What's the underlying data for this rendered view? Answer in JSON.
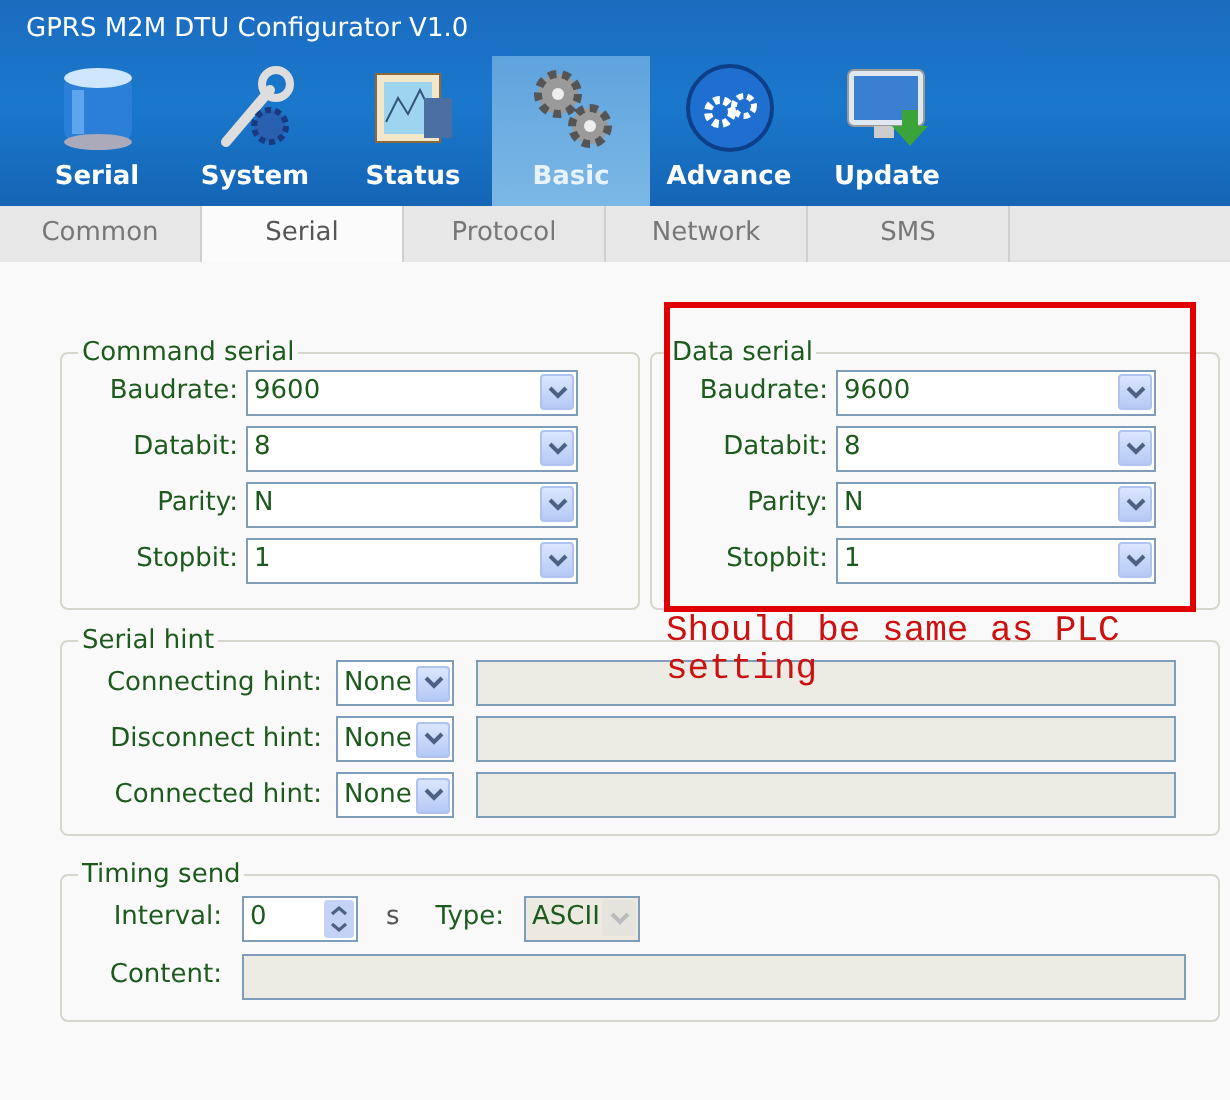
{
  "window": {
    "title": "GPRS M2M DTU Configurator V1.0"
  },
  "toolbar": [
    {
      "label": "Serial",
      "selected": false
    },
    {
      "label": "System",
      "selected": false
    },
    {
      "label": "Status",
      "selected": false
    },
    {
      "label": "Basic",
      "selected": true
    },
    {
      "label": "Advance",
      "selected": false
    },
    {
      "label": "Update",
      "selected": false
    }
  ],
  "tabs": [
    {
      "label": "Common",
      "selected": false
    },
    {
      "label": "Serial",
      "selected": true
    },
    {
      "label": "Protocol",
      "selected": false
    },
    {
      "label": "Network",
      "selected": false
    },
    {
      "label": "SMS",
      "selected": false
    }
  ],
  "command_serial": {
    "title": "Command serial",
    "fields": [
      {
        "label": "Baudrate:",
        "value": "9600"
      },
      {
        "label": "Databit:",
        "value": "8"
      },
      {
        "label": "Parity:",
        "value": "N"
      },
      {
        "label": "Stopbit:",
        "value": "1"
      }
    ]
  },
  "data_serial": {
    "title": "Data serial",
    "fields": [
      {
        "label": "Baudrate:",
        "value": "9600"
      },
      {
        "label": "Databit:",
        "value": "8"
      },
      {
        "label": "Parity:",
        "value": "N"
      },
      {
        "label": "Stopbit:",
        "value": "1"
      }
    ]
  },
  "annotation": "Should be same as PLC setting",
  "serial_hint": {
    "title": "Serial hint",
    "rows": [
      {
        "label": "Connecting hint:",
        "value": "None"
      },
      {
        "label": "Disconnect hint:",
        "value": "None"
      },
      {
        "label": "Connected hint:",
        "value": "None"
      }
    ]
  },
  "timing_send": {
    "title": "Timing send",
    "interval": {
      "label": "Interval:",
      "value": "0",
      "unit": "s"
    },
    "type": {
      "label": "Type:",
      "value": "ASCII",
      "disabled": true
    },
    "content": {
      "label": "Content:"
    }
  }
}
